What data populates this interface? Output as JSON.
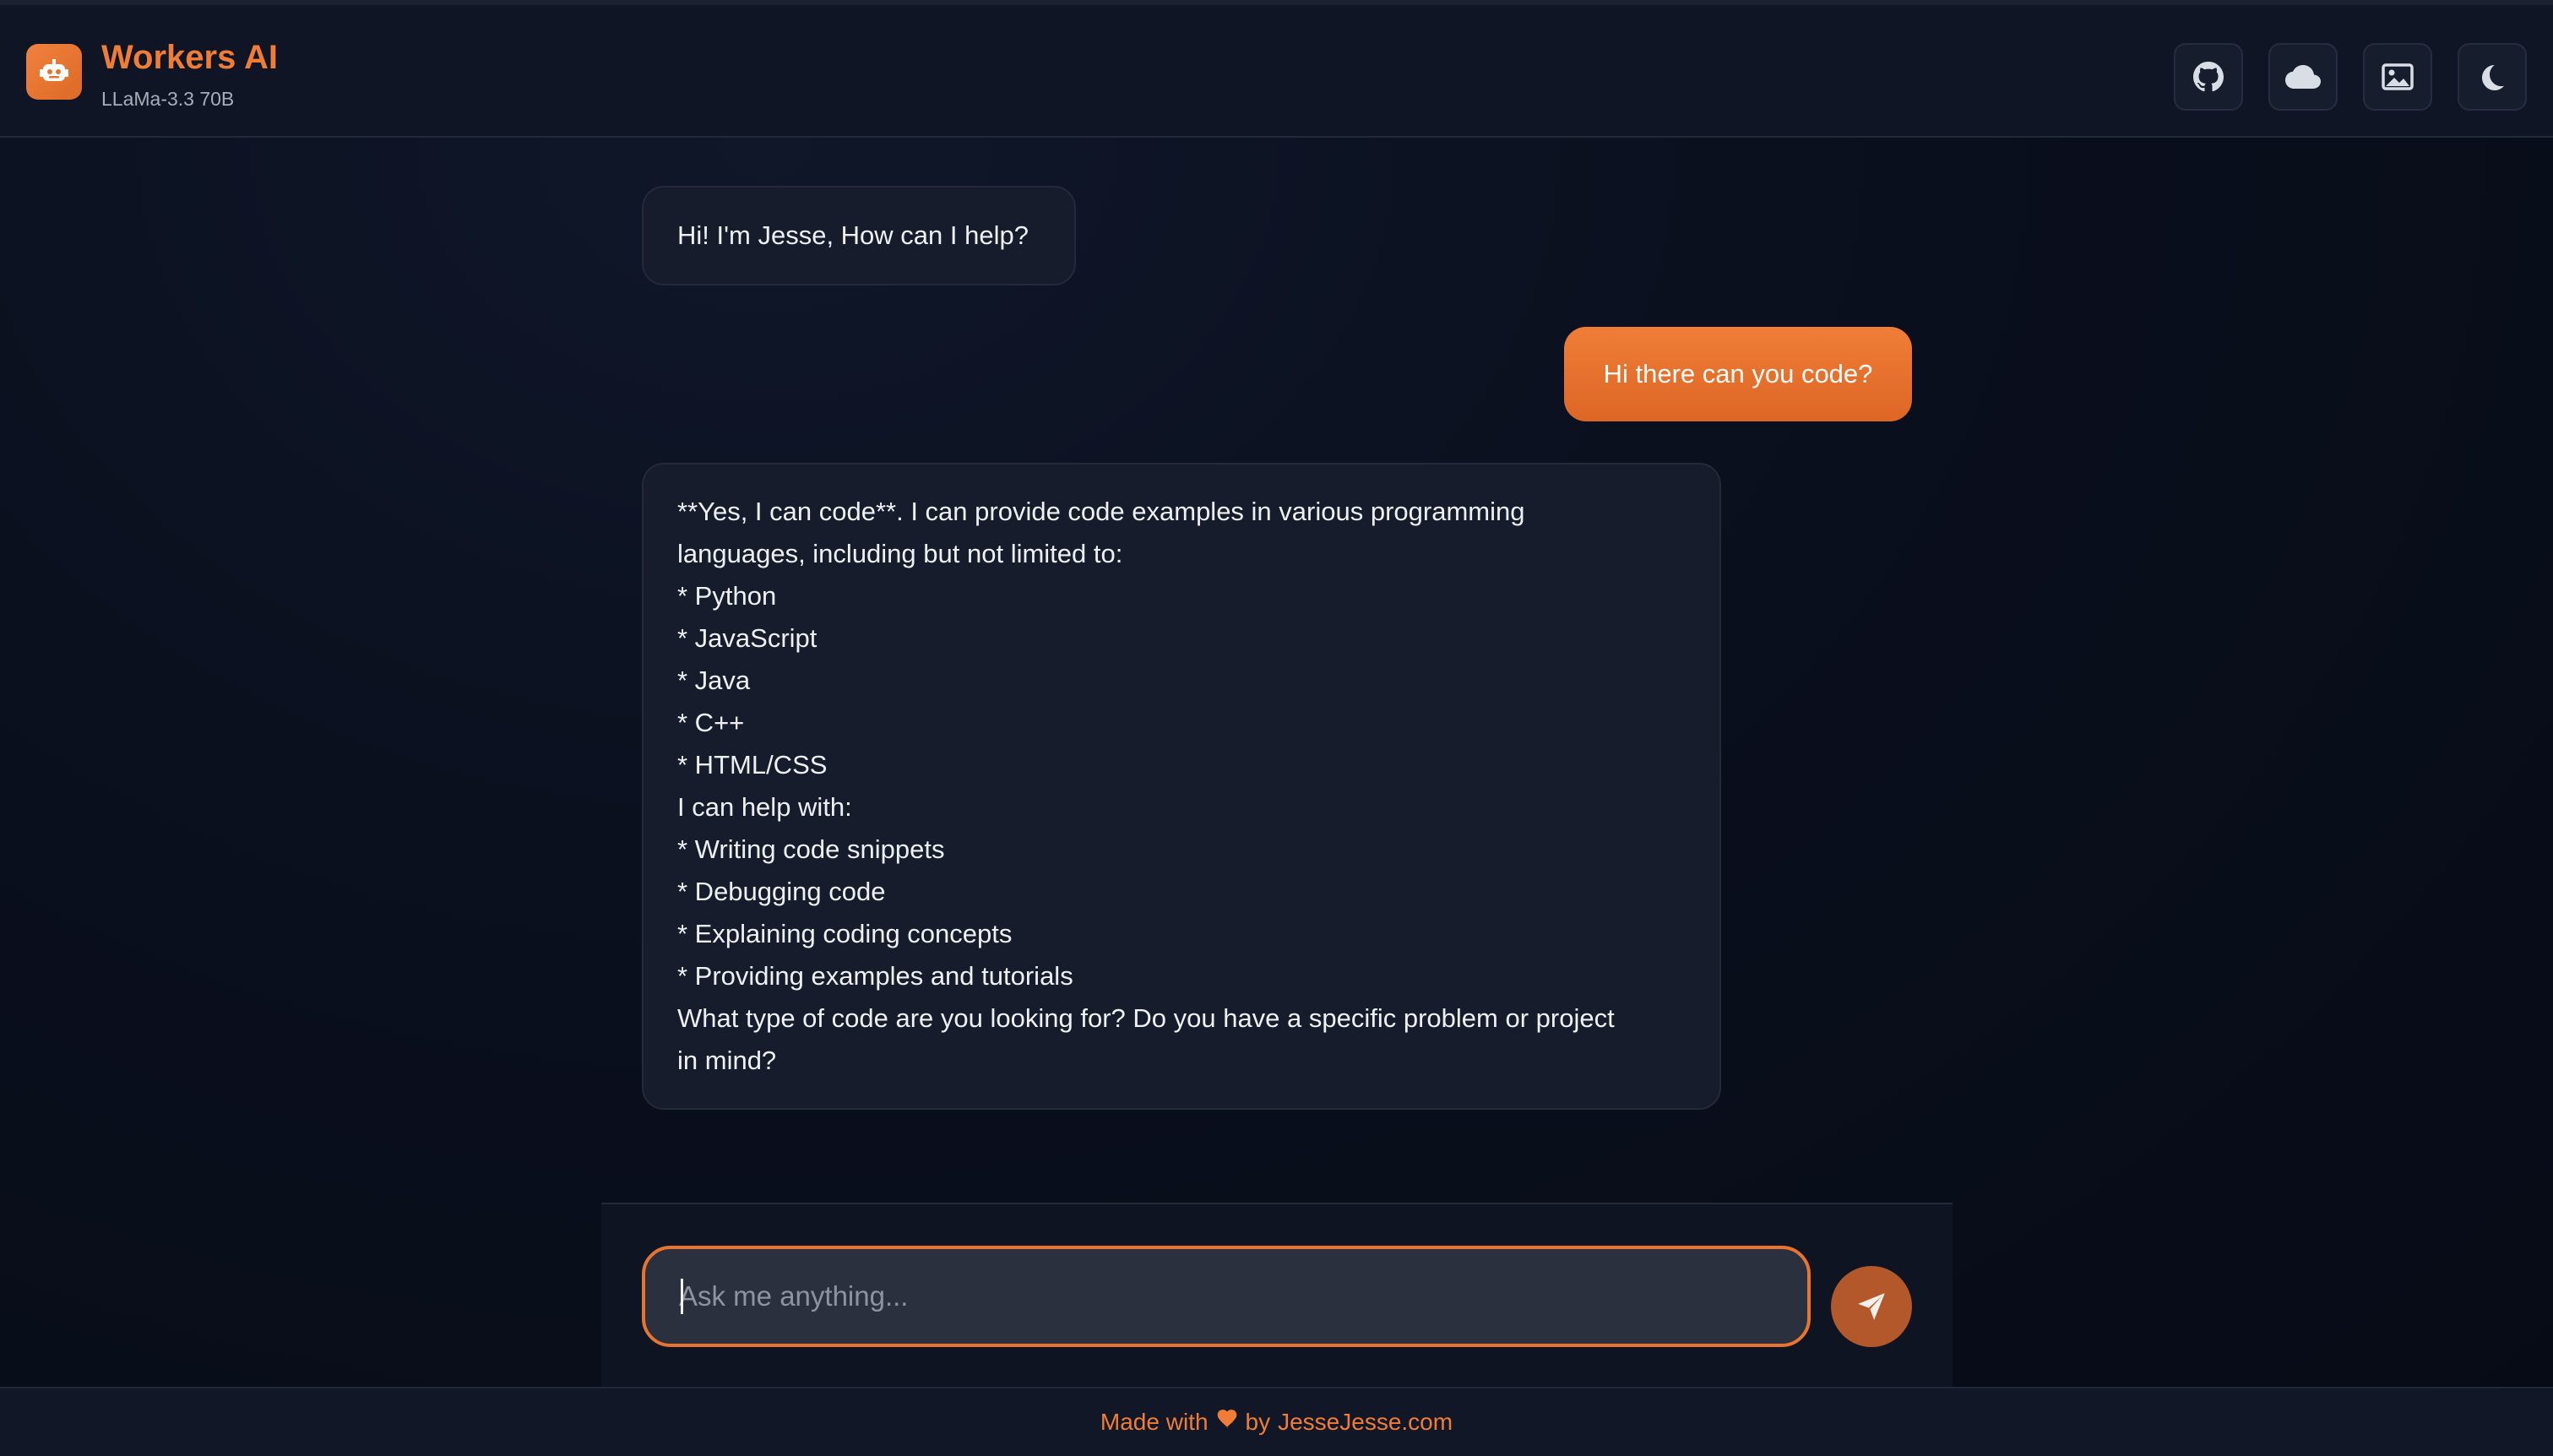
{
  "header": {
    "title": "Workers AI",
    "model": "LLaMa-3.3 70B",
    "buttons": [
      {
        "icon": "github-icon"
      },
      {
        "icon": "cloud-icon"
      },
      {
        "icon": "image-icon"
      },
      {
        "icon": "moon-icon"
      }
    ]
  },
  "chat": {
    "messages": [
      {
        "role": "assistant",
        "lines": [
          "Hi! I'm Jesse, How can I help?"
        ]
      },
      {
        "role": "user",
        "lines": [
          "Hi there can you code?"
        ]
      },
      {
        "role": "assistant",
        "lines": [
          "**Yes, I can code**. I can provide code examples in various programming",
          "languages, including but not limited to:",
          "* Python",
          "* JavaScript",
          "* Java",
          "* C++",
          "* HTML/CSS",
          "I can help with:",
          "* Writing code snippets",
          "* Debugging code",
          "* Explaining coding concepts",
          "* Providing examples and tutorials",
          "What type of code are you looking for? Do you have a specific problem or project",
          "in mind?"
        ]
      }
    ]
  },
  "composer": {
    "placeholder": "Ask me anything...",
    "value": ""
  },
  "footer": {
    "prefix": "Made with",
    "by": "by",
    "link": "JesseJesse.com"
  },
  "colors": {
    "accent": "#ef7d37",
    "background": "#0a0f1d",
    "bubble": "#161c2b"
  }
}
